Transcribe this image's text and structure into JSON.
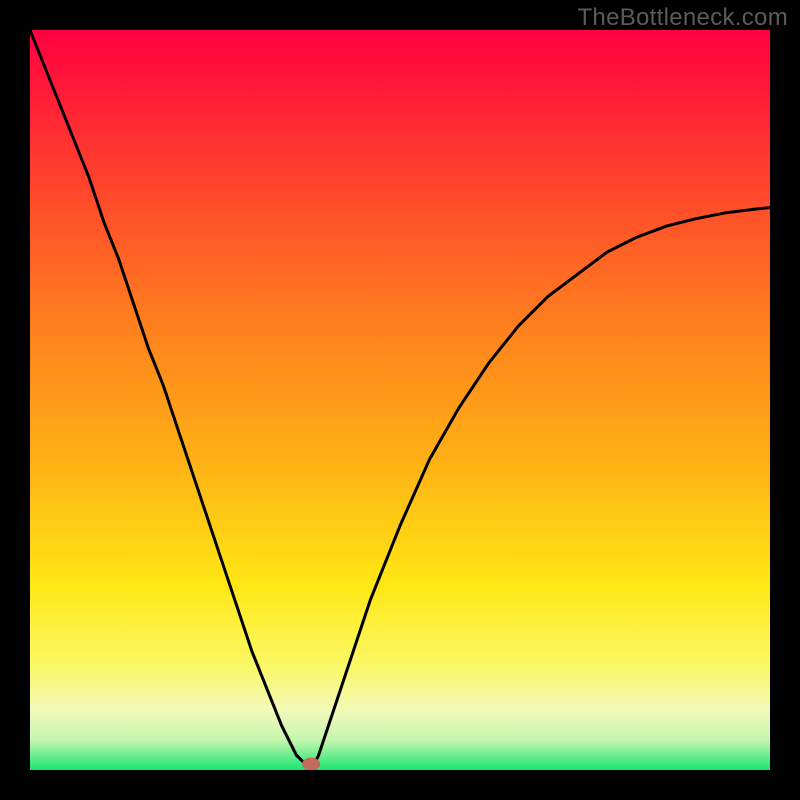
{
  "watermark": "TheBottleneck.com",
  "colors": {
    "frame": "#000000",
    "curve": "#000000",
    "marker": "#c46a5a",
    "gradient_stops": [
      {
        "offset": "0%",
        "color": "#ff0040"
      },
      {
        "offset": "18%",
        "color": "#ff3b2f"
      },
      {
        "offset": "38%",
        "color": "#ff7a1f"
      },
      {
        "offset": "58%",
        "color": "#ffb015"
      },
      {
        "offset": "75%",
        "color": "#ffe714"
      },
      {
        "offset": "86%",
        "color": "#fbf867"
      },
      {
        "offset": "92%",
        "color": "#f2f9b8"
      },
      {
        "offset": "96%",
        "color": "#c4f6ae"
      },
      {
        "offset": "100%",
        "color": "#19e56f"
      }
    ]
  },
  "chart_data": {
    "type": "line",
    "title": "",
    "xlabel": "",
    "ylabel": "",
    "xlim": [
      0,
      100
    ],
    "ylim": [
      0,
      100
    ],
    "optimal_x": 38,
    "series": [
      {
        "name": "bottleneck-curve",
        "x": [
          0,
          2,
          4,
          6,
          8,
          10,
          12,
          14,
          16,
          18,
          20,
          22,
          24,
          26,
          28,
          30,
          32,
          34,
          35,
          36,
          37,
          38,
          39,
          40,
          42,
          44,
          46,
          48,
          50,
          54,
          58,
          62,
          66,
          70,
          74,
          78,
          82,
          86,
          90,
          94,
          98,
          100
        ],
        "y": [
          100,
          95,
          90,
          85,
          80,
          74,
          69,
          63,
          57,
          52,
          46,
          40,
          34,
          28,
          22,
          16,
          11,
          6,
          4,
          2,
          1,
          0,
          2,
          5,
          11,
          17,
          23,
          28,
          33,
          42,
          49,
          55,
          60,
          64,
          67,
          70,
          72,
          73.5,
          74.5,
          75.3,
          75.8,
          76
        ]
      }
    ]
  }
}
